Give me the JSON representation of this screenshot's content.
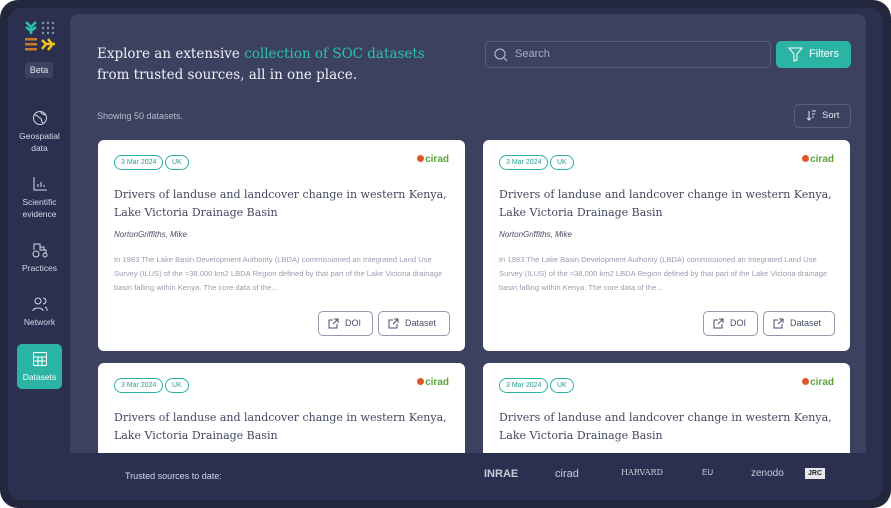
{
  "sidebar": {
    "beta": "Beta",
    "items": [
      {
        "label": "Geospatial data",
        "icon": "globe-icon"
      },
      {
        "label": "Scientific evidence",
        "icon": "bar-chart-icon"
      },
      {
        "label": "Practices",
        "icon": "tractor-icon"
      },
      {
        "label": "Network",
        "icon": "users-icon"
      },
      {
        "label": "Datasets",
        "icon": "table-icon",
        "active": true
      }
    ]
  },
  "header": {
    "headline_pre": "Explore an extensive ",
    "headline_highlight": "collection of SOC datasets",
    "headline_post": " from trusted sources, all in one place.",
    "search_placeholder": "Search",
    "filters": "Filters"
  },
  "results": {
    "showing": "Showing 50 datasets.",
    "sort": "Sort"
  },
  "cards": [
    {
      "date": "3 Mar 2024",
      "country": "UK",
      "source": "cirad",
      "title": "Drivers of landuse and landcover change in western Kenya, Lake Victoria Drainage Basin",
      "author": "NortonGriffiths, Mike",
      "description": "In 1983 The Lake Basin Development Authority (LBDA) commissioned an Integrated Land Use Survey (ILUS) of the ≈38,000 km2 LBDA Region defined by that part of the Lake Victoria drainage basin falling within Kenya. The core data of the...",
      "doi": "DOI",
      "dataset": "Dataset"
    },
    {
      "date": "3 Mar 2024",
      "country": "UK",
      "source": "cirad",
      "title": "Drivers of landuse and landcover change in western Kenya, Lake Victoria Drainage Basin",
      "author": "NortonGriffiths, Mike",
      "description": "In 1983 The Lake Basin Development Authority (LBDA) commissioned an Integrated Land Use Survey (ILUS) of the ≈38,000 km2 LBDA Region defined by that part of the Lake Victoria drainage basin falling within Kenya. The core data of the...",
      "doi": "DOI",
      "dataset": "Dataset"
    },
    {
      "date": "3 Mar 2024",
      "country": "UK",
      "source": "cirad",
      "title": "Drivers of landuse and landcover change in western Kenya, Lake Victoria Drainage Basin"
    },
    {
      "date": "3 Mar 2024",
      "country": "UK",
      "source": "cirad",
      "title": "Drivers of landuse and landcover change in western Kenya, Lake Victoria Drainage Basin"
    }
  ],
  "footer": {
    "label": "Trusted sources to date:",
    "sources": [
      "INRAE",
      "cirad",
      "HARVARD",
      "EU",
      "zenodo",
      "JRC"
    ]
  },
  "colors": {
    "accent": "#2bb3a3",
    "panel": "#3c4160",
    "sidebar": "#2c3050"
  }
}
